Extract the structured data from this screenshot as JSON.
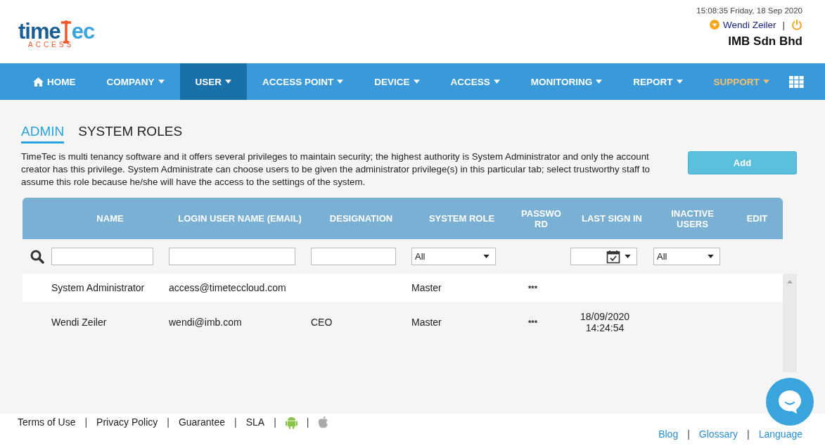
{
  "header": {
    "datetime": "15:08:35 Friday, 18 Sep 2020",
    "user": "Wendi Zeiler",
    "separator": "|",
    "company": "IMB Sdn Bhd",
    "logo": {
      "word_a": "time",
      "word_b": "ec",
      "sub": "ACCESS"
    }
  },
  "nav": [
    {
      "label": "HOME",
      "kind": "home",
      "dropdown": false,
      "selected": false,
      "highlighted": false
    },
    {
      "label": "COMPANY",
      "dropdown": true,
      "selected": false,
      "highlighted": false
    },
    {
      "label": "USER",
      "dropdown": true,
      "selected": true,
      "highlighted": false
    },
    {
      "label": "ACCESS POINT",
      "dropdown": true,
      "selected": false,
      "highlighted": false
    },
    {
      "label": "DEVICE",
      "dropdown": true,
      "selected": false,
      "highlighted": false
    },
    {
      "label": "ACCESS",
      "dropdown": true,
      "selected": false,
      "highlighted": false
    },
    {
      "label": "MONITORING",
      "dropdown": true,
      "selected": false,
      "highlighted": false
    },
    {
      "label": "REPORT",
      "dropdown": true,
      "selected": false,
      "highlighted": false
    },
    {
      "label": "SUPPORT",
      "dropdown": true,
      "selected": false,
      "highlighted": true
    }
  ],
  "tabs": [
    {
      "label": "ADMIN",
      "selected": true
    },
    {
      "label": "SYSTEM ROLES",
      "selected": false
    }
  ],
  "description": "TimeTec is multi tenancy software and it offers several privileges to maintain security; the highest authority is System Administrator and only the account creator has this privilege. System Administrate can choose users to be given the administrator privilege(s) in this particular tab; select trustworthy staff to assume this role because he/she will have the access to the settings of the system.",
  "add_button": "Add",
  "table": {
    "columns": [
      "NAME",
      "LOGIN USER NAME (EMAIL)",
      "DESIGNATION",
      "SYSTEM ROLE",
      "PASSWO RD",
      "LAST SIGN IN",
      "INACTIVE USERS",
      "EDIT"
    ],
    "filters": [
      {
        "kind": "text"
      },
      {
        "kind": "text"
      },
      {
        "kind": "text"
      },
      {
        "kind": "select",
        "value": "All"
      },
      {
        "kind": "none"
      },
      {
        "kind": "date"
      },
      {
        "kind": "select",
        "value": "All"
      },
      {
        "kind": "none"
      }
    ],
    "rows": [
      {
        "cells": [
          "System Administrator",
          "access@timeteccloud.com",
          "",
          "Master",
          "***",
          "",
          "",
          ""
        ]
      },
      {
        "cells": [
          "Wendi Zeiler",
          "wendi@imb.com",
          "CEO",
          "Master",
          "***",
          "18/09/2020 14:24:54",
          "",
          ""
        ]
      }
    ]
  },
  "footer": {
    "left": [
      "Terms of Use",
      "Privacy Policy",
      "Guarantee",
      "SLA"
    ],
    "right": [
      "Blog",
      "Glossary",
      "Language"
    ],
    "separator": "|"
  }
}
